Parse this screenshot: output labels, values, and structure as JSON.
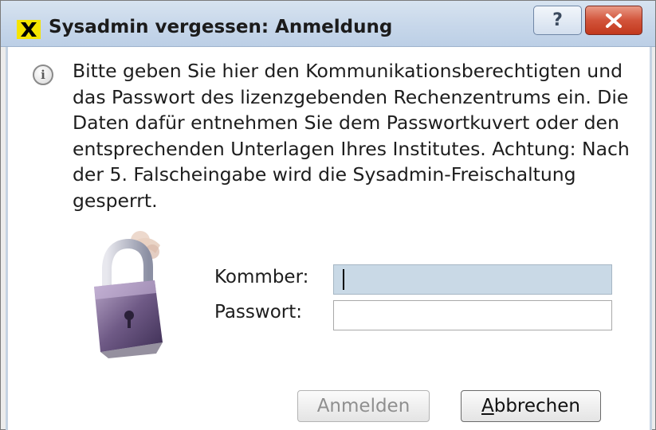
{
  "window": {
    "title": "Sysadmin vergessen: Anmeldung",
    "help_label": "?",
    "close_label": "x"
  },
  "message": {
    "icon": "info-icon",
    "text": "Bitte geben Sie hier den Kommunikationsberechtigten und das Passwort des lizenzgebenden Rechenzentrums ein. Die Daten dafür entnehmen Sie dem Passwortkuvert oder den entsprechenden Unterlagen Ihres Institutes. Achtung: Nach der 5. Falscheingabe wird die Sysadmin-Freischaltung gesperrt."
  },
  "form": {
    "kommber_label": "Kommber:",
    "kommber_value": "",
    "passwort_label": "Passwort:",
    "passwort_value": ""
  },
  "buttons": {
    "anmelden_label": "Anmelden",
    "abbrechen_mnemonic": "A",
    "abbrechen_rest": "bbrechen"
  },
  "colors": {
    "title_icon_bg": "#f5e400",
    "close_button": "#c2381c",
    "focused_field": "#c9d9e6"
  }
}
